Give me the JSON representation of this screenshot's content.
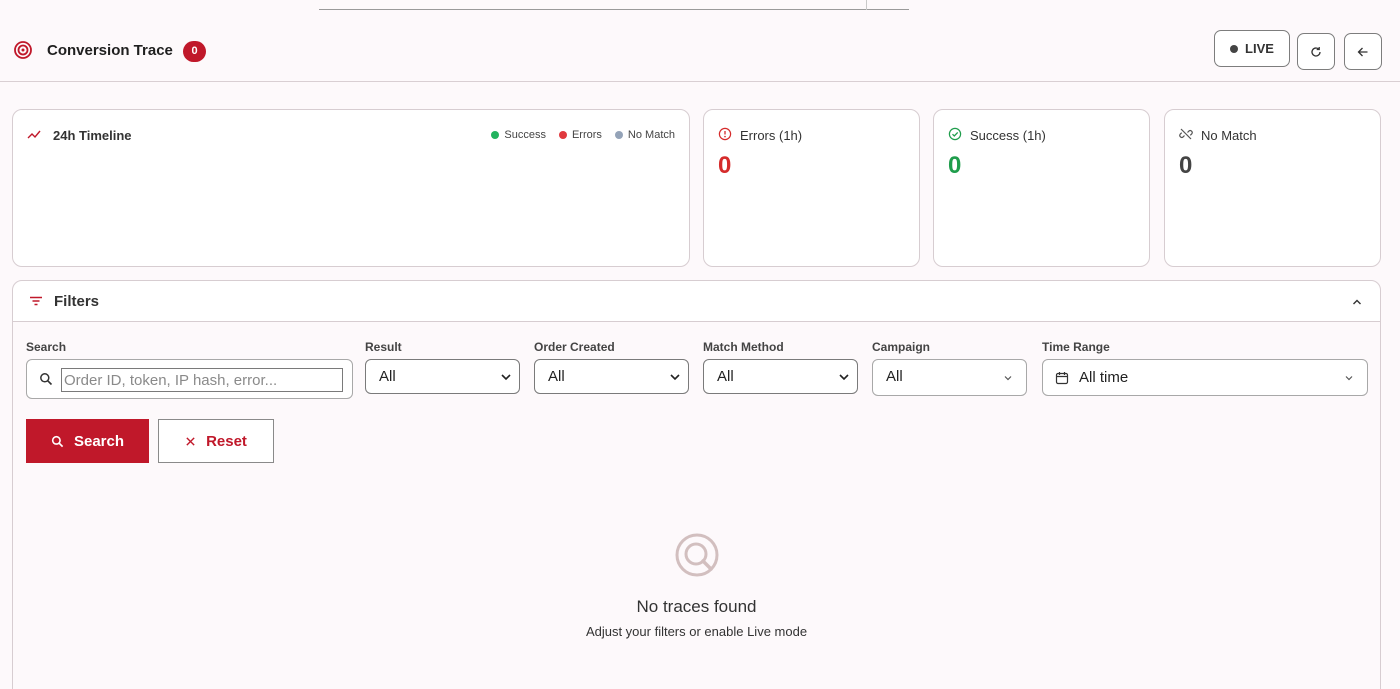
{
  "header": {
    "title": "Conversion Trace",
    "badge_count": "0",
    "live_label": "LIVE"
  },
  "timeline": {
    "title": "24h Timeline",
    "legend": [
      {
        "label": "Success",
        "color": "#22b35e"
      },
      {
        "label": "Errors",
        "color": "#e0393e"
      },
      {
        "label": "No Match",
        "color": "#94a3b8"
      }
    ]
  },
  "stats": {
    "errors": {
      "label": "Errors (1h)",
      "value": "0",
      "color": "#d52b2b"
    },
    "success": {
      "label": "Success (1h)",
      "value": "0",
      "color": "#1f9d4c"
    },
    "no_match": {
      "label": "No Match",
      "value": "0",
      "color": "#444444"
    }
  },
  "filters": {
    "title": "Filters",
    "search": {
      "label": "Search",
      "placeholder": "Order ID, token, IP hash, error..."
    },
    "result": {
      "label": "Result",
      "value": "All"
    },
    "order_created": {
      "label": "Order Created",
      "value": "All"
    },
    "match_method": {
      "label": "Match Method",
      "value": "All"
    },
    "campaign": {
      "label": "Campaign",
      "value": "All"
    },
    "time_range": {
      "label": "Time Range",
      "value": "All time"
    },
    "search_button": "Search",
    "reset_button": "Reset"
  },
  "empty_state": {
    "title": "No traces found",
    "subtitle": "Adjust your filters or enable Live mode"
  },
  "colors": {
    "accent": "#c0182a",
    "background": "#fdf9fb"
  }
}
